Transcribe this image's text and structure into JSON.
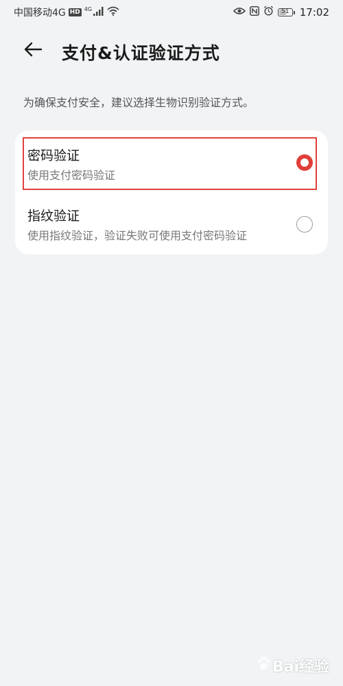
{
  "status_bar": {
    "carrier": "中国移动4G",
    "hd_badge": "HD",
    "network_tag": "4G",
    "battery": "51",
    "battery_level": 0.51,
    "time": "17:02"
  },
  "header": {
    "title": "支付&认证验证方式"
  },
  "subtitle": "为确保支付安全，建议选择生物识别验证方式。",
  "options": [
    {
      "title": "密码验证",
      "description": "使用支付密码验证",
      "selected": true
    },
    {
      "title": "指纹验证",
      "description": "使用指纹验证，验证失败可使用支付密码验证",
      "selected": false
    }
  ],
  "colors": {
    "accent": "#e0403a",
    "background": "#f1f3f5",
    "card": "#ffffff"
  },
  "watermark": {
    "text": "Bai经验"
  }
}
